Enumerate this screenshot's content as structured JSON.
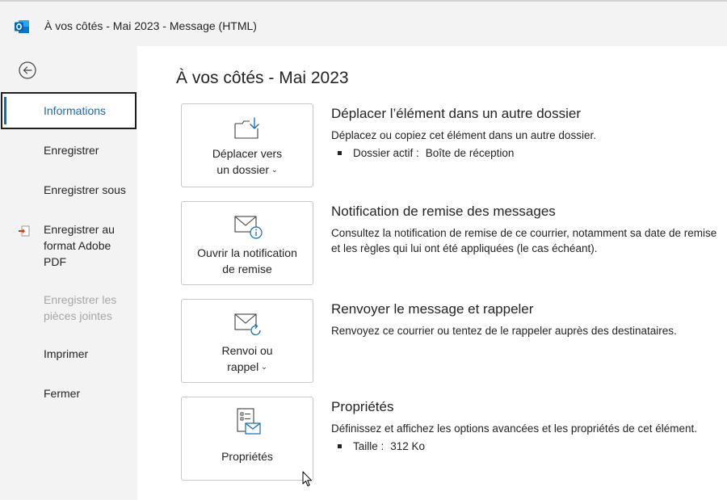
{
  "window": {
    "title": "À vos côtés - Mai 2023  -  Message (HTML)"
  },
  "sidebar": {
    "items": [
      {
        "label": "Informations"
      },
      {
        "label": "Enregistrer"
      },
      {
        "label": "Enregistrer sous"
      },
      {
        "label": "Enregistrer au format Adobe PDF"
      },
      {
        "label": "Enregistrer les pièces jointes"
      },
      {
        "label": "Imprimer"
      },
      {
        "label": "Fermer"
      }
    ]
  },
  "main": {
    "title": "À vos côtés - Mai 2023",
    "sections": [
      {
        "button_line1": "Déplacer vers",
        "button_line2": "un dossier",
        "title": "Déplacer l’élément dans un autre dossier",
        "description": "Déplacez ou copiez cet élément dans un autre dossier.",
        "detail_label": "Dossier actif :",
        "detail_value": "Boîte de réception"
      },
      {
        "button_line1": "Ouvrir la notification",
        "button_line2": "de remise",
        "title": "Notification de remise des messages",
        "description": "Consultez la notification de remise de ce courrier, notamment sa date de remise et les règles qui lui ont été appliquées (le cas échéant)."
      },
      {
        "button_line1": "Renvoi ou",
        "button_line2": "rappel",
        "title": "Renvoyer le message et rappeler",
        "description": "Renvoyez ce courrier ou tentez de le rappeler auprès des destinataires."
      },
      {
        "button_line1": "Propriétés",
        "title": "Propriétés",
        "description": "Définissez et affichez les options avancées et les propriétés de cet élément.",
        "detail_label": "Taille :",
        "detail_value": "312 Ko"
      }
    ]
  },
  "colors": {
    "accent": "#0f6cbd",
    "sidebar_bg": "#f3f3f3",
    "main_bg": "#ffffff"
  }
}
